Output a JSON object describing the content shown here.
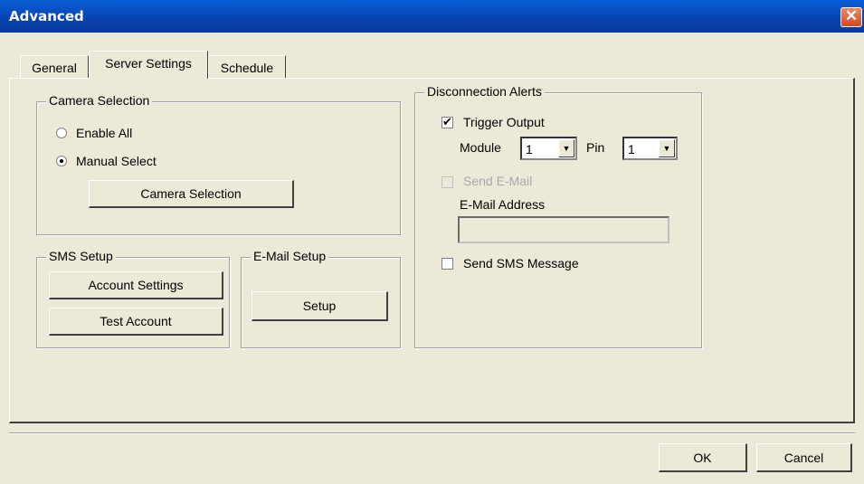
{
  "window": {
    "title": "Advanced"
  },
  "tabs": [
    {
      "label": "General"
    },
    {
      "label": "Server Settings"
    },
    {
      "label": "Schedule"
    }
  ],
  "camera_selection": {
    "group_label": "Camera Selection",
    "enable_all_label": "Enable All",
    "manual_select_label": "Manual Select",
    "selected": "Manual Select",
    "button_label": "Camera Selection"
  },
  "sms_setup": {
    "group_label": "SMS Setup",
    "account_settings_label": "Account Settings",
    "test_account_label": "Test Account"
  },
  "email_setup": {
    "group_label": "E-Mail Setup",
    "setup_label": "Setup"
  },
  "disconnection_alerts": {
    "group_label": "Disconnection Alerts",
    "trigger_output_label": "Trigger Output",
    "trigger_output_checked": true,
    "module_label": "Module",
    "module_value": "1",
    "pin_label": "Pin",
    "pin_value": "1",
    "send_email_label": "Send E-Mail",
    "send_email_checked": false,
    "email_address_label": "E-Mail Address",
    "email_address_value": "",
    "send_sms_label": "Send SMS Message",
    "send_sms_checked": false
  },
  "footer": {
    "ok_label": "OK",
    "cancel_label": "Cancel"
  }
}
